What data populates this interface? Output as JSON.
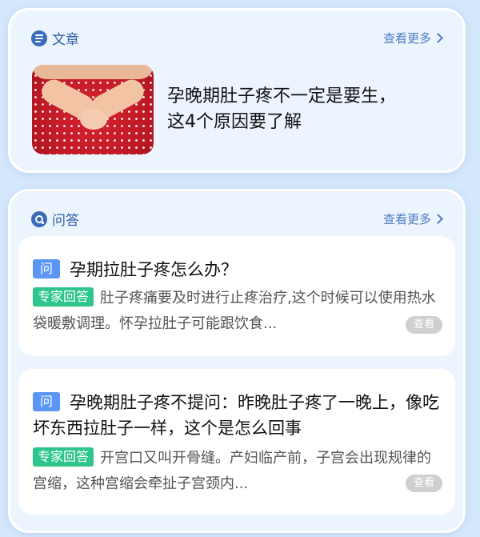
{
  "article_section": {
    "title": "文章",
    "more": "查看更多",
    "article": {
      "title_line1": "孕晚期肚子疼不一定是要生，",
      "title_line2": "这4个原因要了解"
    }
  },
  "qa_section": {
    "title": "问答",
    "more": "查看更多",
    "items": [
      {
        "tag": "问",
        "question": "孕期拉肚子疼怎么办？",
        "expert_tag": "专家回答",
        "answer": "肚子疼痛要及时进行止疼治疗,这个时候可以使用热水袋暖敷调理。怀孕拉肚子可能跟饮食...",
        "view": "查看"
      },
      {
        "tag": "问",
        "question": "孕晚期肚子疼不提问：昨晚肚子疼了一晚上，像吃坏东西拉肚子一样，这个是怎么回事",
        "expert_tag": "专家回答",
        "answer": "开宫口又叫开骨缝。产妇临产前，子宫会出现规律的宫缩，这种宫缩会牵扯子宫颈内...",
        "view": "查看"
      }
    ]
  },
  "colors": {
    "background": "#d5e8fb",
    "accent_blue": "#2e5ea6",
    "question_tag": "#5b97f2",
    "expert_tag": "#2dc58a"
  },
  "icons": {
    "article": "document-icon",
    "qa": "qa-bubble-icon",
    "more": "chevron-right-icon"
  }
}
